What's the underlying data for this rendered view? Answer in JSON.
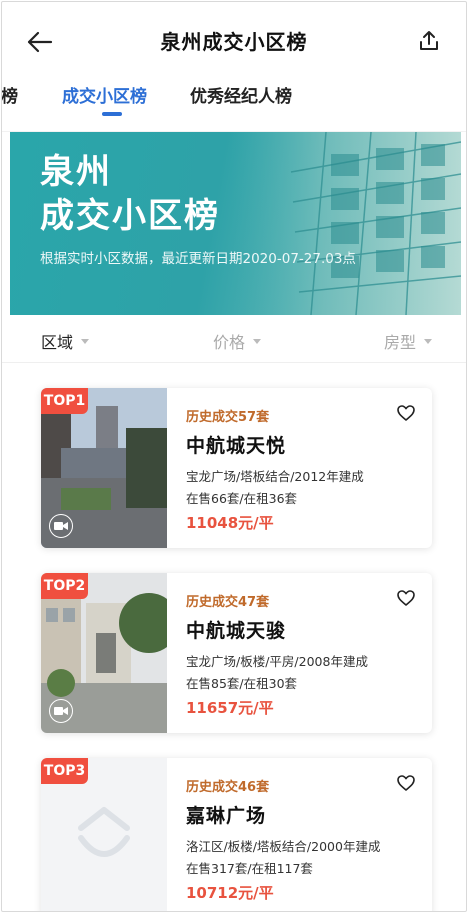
{
  "header": {
    "title": "泉州成交小区榜",
    "back_icon": "arrow-left-icon",
    "share_icon": "share-upload-icon"
  },
  "tabs": [
    {
      "label": "区榜",
      "active": false
    },
    {
      "label": "成交小区榜",
      "active": true
    },
    {
      "label": "优秀经纪人榜",
      "active": false
    }
  ],
  "banner": {
    "title_line1": "泉州",
    "title_line2": "成交小区榜",
    "subtitle": "根据实时小区数据，最近更新日期2020-07-27.03点"
  },
  "filters": [
    {
      "label": "区域"
    },
    {
      "label": "价格"
    },
    {
      "label": "房型"
    }
  ],
  "colors": {
    "accent": "#2d6fd6",
    "badge": "#f04f3f",
    "price": "#e8533f",
    "history": "#c06a2b",
    "banner": "#2ea2a8"
  },
  "cards": [
    {
      "rank": "TOP1",
      "history": "历史成交57套",
      "name": "中航城天悦",
      "location": "宝龙广场/塔板结合/2012年建成",
      "listing": "在售66套/在租36套",
      "price": "11048元/平",
      "has_video": true
    },
    {
      "rank": "TOP2",
      "history": "历史成交47套",
      "name": "中航城天骏",
      "location": "宝龙广场/板楼/平房/2008年建成",
      "listing": "在售85套/在租30套",
      "price": "11657元/平",
      "has_video": true
    },
    {
      "rank": "TOP3",
      "history": "历史成交46套",
      "name": "嘉琳广场",
      "location": "洛江区/板楼/塔板结合/2000年建成",
      "listing": "在售317套/在租117套",
      "price": "10712元/平",
      "has_video": false
    }
  ]
}
